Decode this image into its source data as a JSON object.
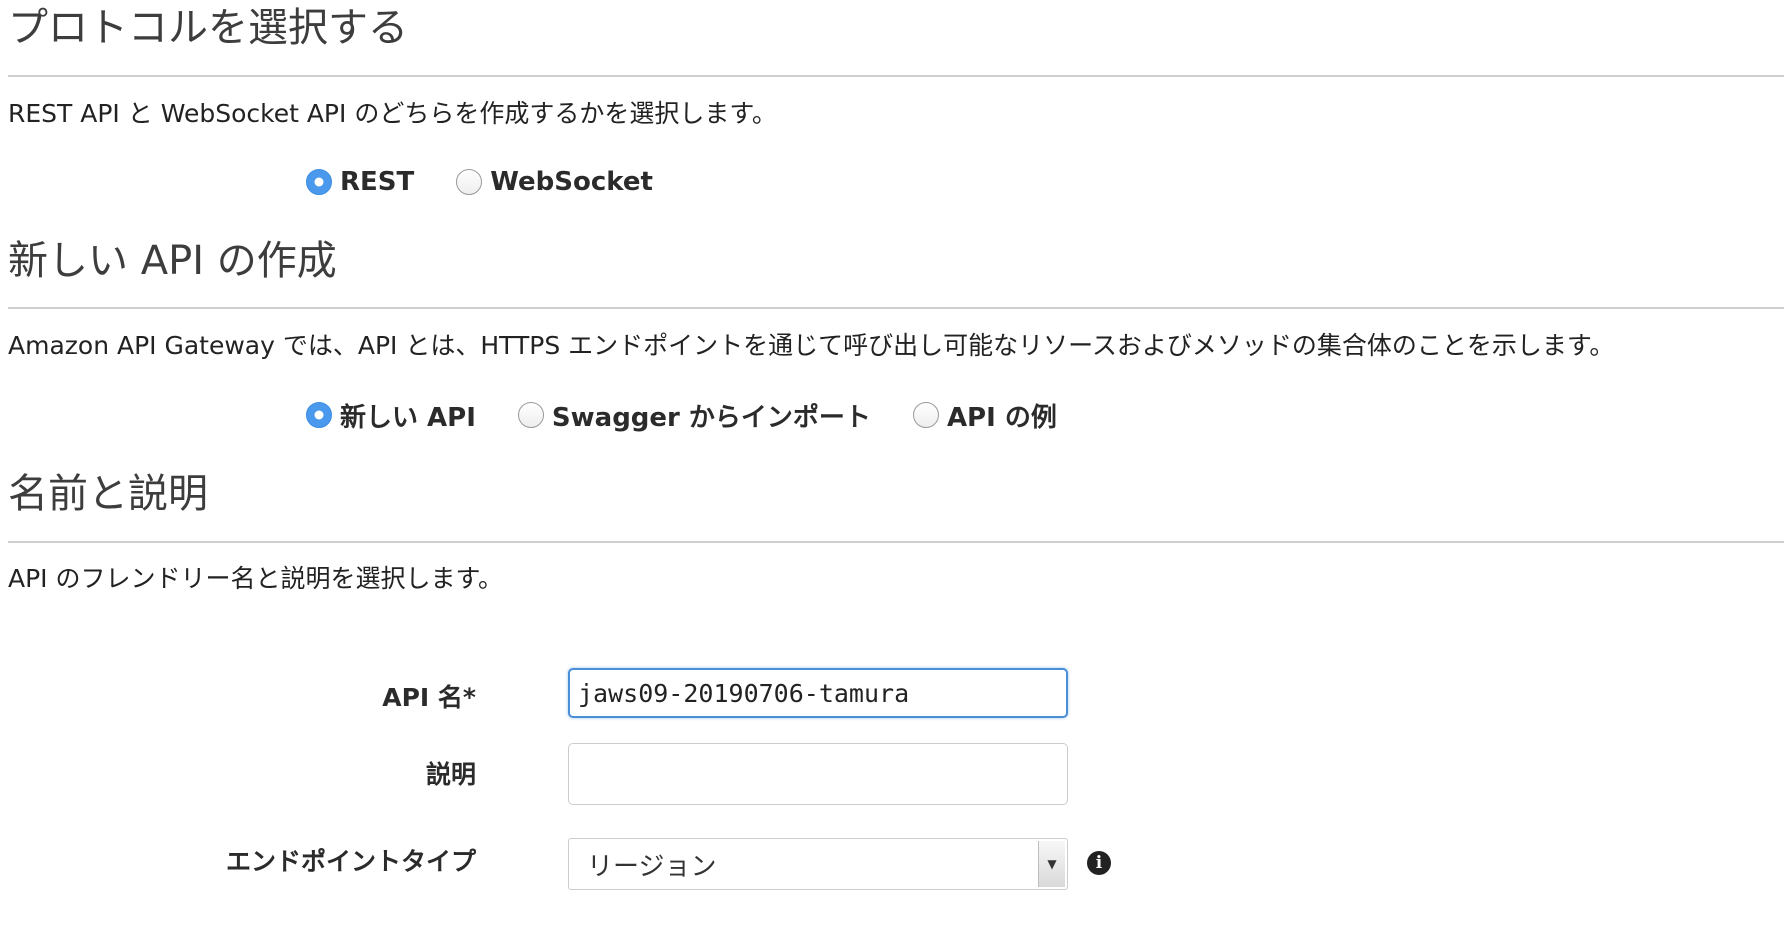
{
  "protocol": {
    "title": "プロトコルを選択する",
    "description": "REST API と WebSocket API のどちらを作成するかを選択します。",
    "options": [
      {
        "label": "REST",
        "checked": true
      },
      {
        "label": "WebSocket",
        "checked": false
      }
    ]
  },
  "create_api": {
    "title": "新しい API の作成",
    "description": "Amazon API Gateway では、API とは、HTTPS エンドポイントを通じて呼び出し可能なリソースおよびメソッドの集合体のことを示します。",
    "options": [
      {
        "label": "新しい API",
        "checked": true
      },
      {
        "label": "Swagger からインポート",
        "checked": false
      },
      {
        "label": "API の例",
        "checked": false
      }
    ]
  },
  "name_description": {
    "title": "名前と説明",
    "description": "API のフレンドリー名と説明を選択します。",
    "api_name_label": "API 名*",
    "api_name_value": "jaws09-20190706-tamura",
    "description_label": "説明",
    "description_value": "",
    "endpoint_type_label": "エンドポイントタイプ",
    "endpoint_type_value": "リージョン"
  },
  "icons": {
    "info": "info-icon",
    "dropdown": "chevron-down-icon"
  },
  "colors": {
    "accent": "#4a99ec",
    "focus_border": "#4a8fd6",
    "rule": "#cfcfcf"
  }
}
